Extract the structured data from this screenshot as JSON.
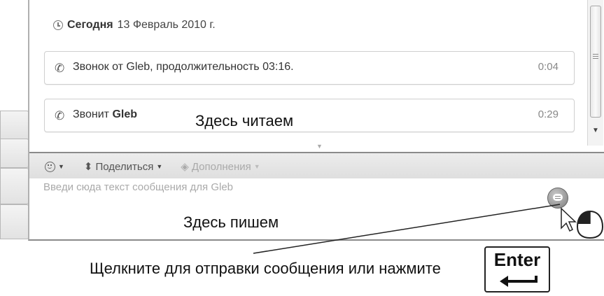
{
  "history": {
    "date_label_bold": "Сегодня",
    "date_label_rest": "13 Февраль 2010 г.",
    "messages": [
      {
        "text": "Звонок от Gleb, продолжительность 03:16.",
        "time": "0:04"
      },
      {
        "text_prefix": "Звонит ",
        "text_bold": "Gleb",
        "time": "0:29"
      }
    ]
  },
  "annotations": {
    "read_here": "Здесь читаем",
    "write_here": "Здесь пишем",
    "caption": "Щелкните для отправки сообщения или нажмите",
    "enter_key": "Enter"
  },
  "toolbar": {
    "share_label": "Поделиться",
    "addons_label": "Дополнения"
  },
  "compose": {
    "placeholder": "Введи сюда текст сообщения для Gleb"
  },
  "colors": {
    "toolbar_bg": "#e4e4e4",
    "border": "#8a8a8a",
    "send_button": "#8e8e8e"
  },
  "icons": [
    "clock-icon",
    "phone-icon",
    "smiley-icon",
    "share-icon",
    "puzzle-icon",
    "send-icon",
    "cursor-icon",
    "mouse-icon",
    "enter-arrow-icon"
  ]
}
